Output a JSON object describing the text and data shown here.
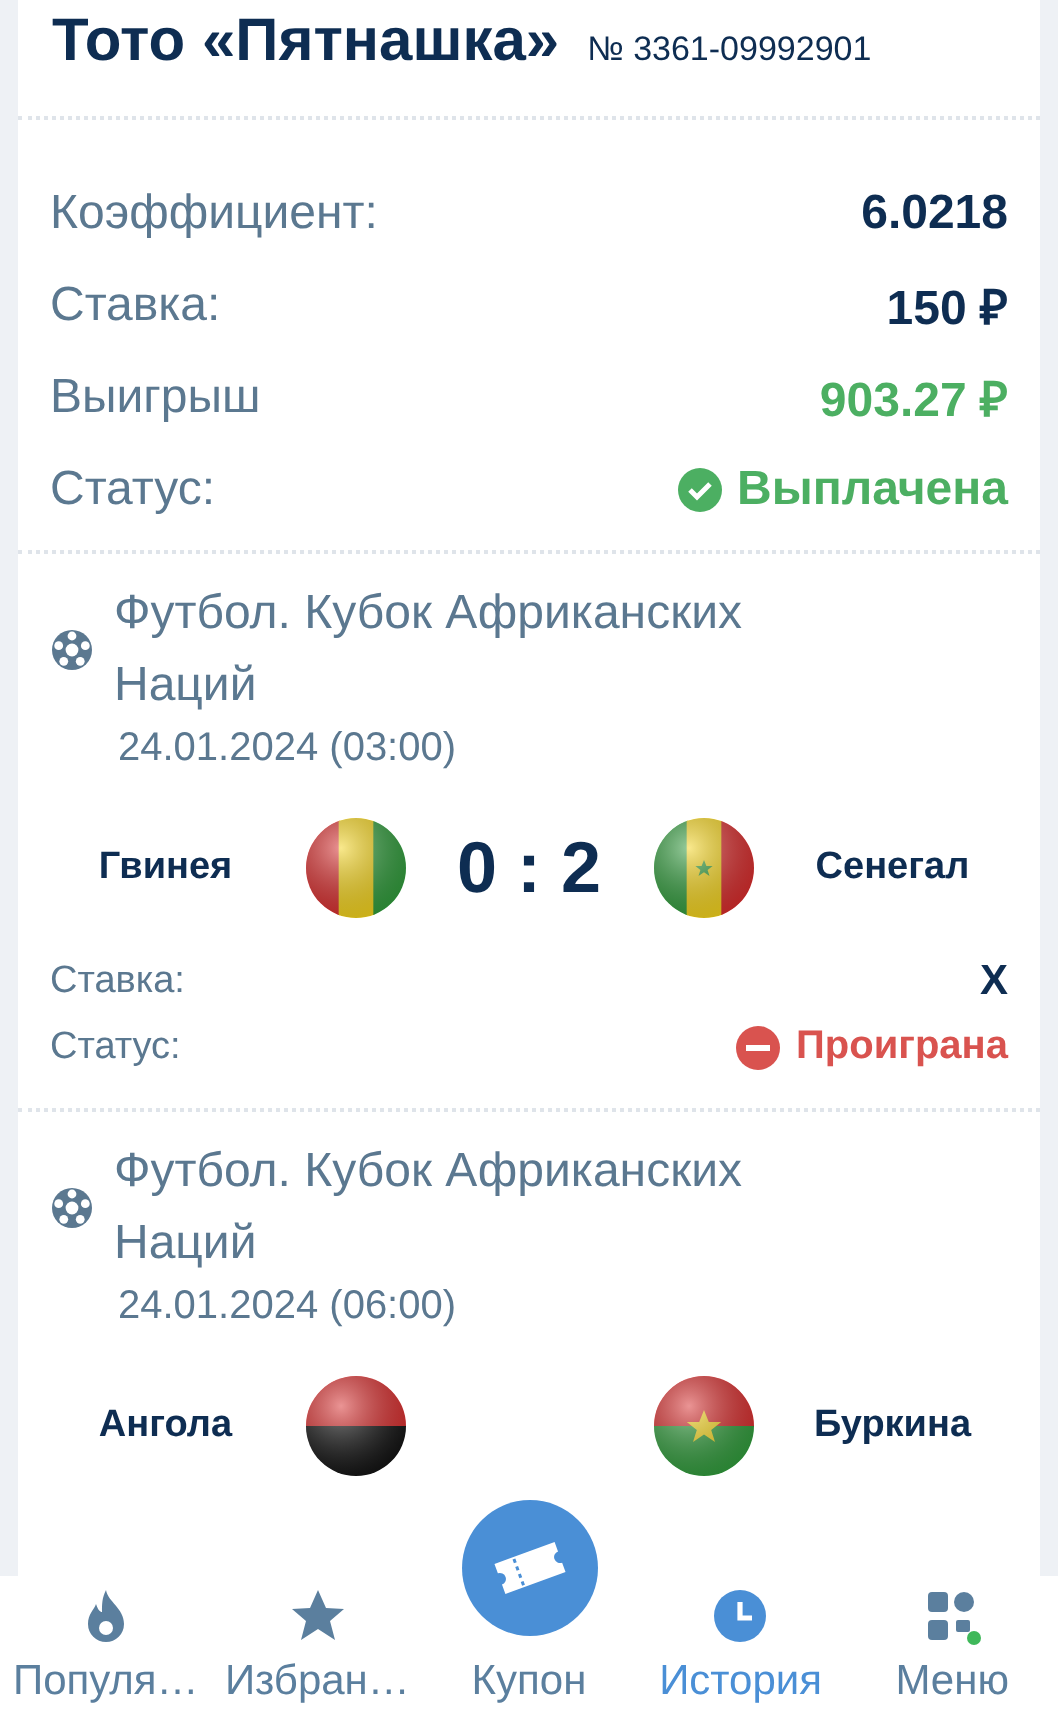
{
  "header": {
    "title": "Тото «Пятнашка»",
    "number": "№ 3361-09992901"
  },
  "summary": [
    {
      "label": "Коэффициент:",
      "value": "6.0218",
      "kind": "plain"
    },
    {
      "label": "Ставка:",
      "value": "150 ₽",
      "kind": "plain"
    },
    {
      "label": "Выигрыш",
      "value": "903.27 ₽",
      "kind": "win"
    },
    {
      "label": "Статус:",
      "value": "Выплачена",
      "kind": "paid"
    }
  ],
  "events": [
    {
      "tournament": "Футбол. Кубок Африканских Наций",
      "date": "24.01.2024 (03:00)",
      "home": "Гвинея",
      "away": "Сенегал",
      "score": "0 : 2",
      "stake_label": "Ставка:",
      "stake": "X",
      "status_label": "Статус:",
      "status": {
        "text": "Проиграна",
        "kind": "lost"
      }
    },
    {
      "tournament": "Футбол. Кубок Африканских Наций",
      "date": "24.01.2024 (06:00)",
      "home": "Ангола",
      "away": "Буркина"
    }
  ],
  "nav": [
    {
      "label": "Популя…",
      "kind": "tab",
      "selected": false
    },
    {
      "label": "Избран…",
      "kind": "tab",
      "selected": false
    },
    {
      "label": "Купон",
      "kind": "center",
      "selected": false
    },
    {
      "label": "История",
      "kind": "tab",
      "selected": true
    },
    {
      "label": "Меню",
      "kind": "tab",
      "selected": false
    }
  ]
}
